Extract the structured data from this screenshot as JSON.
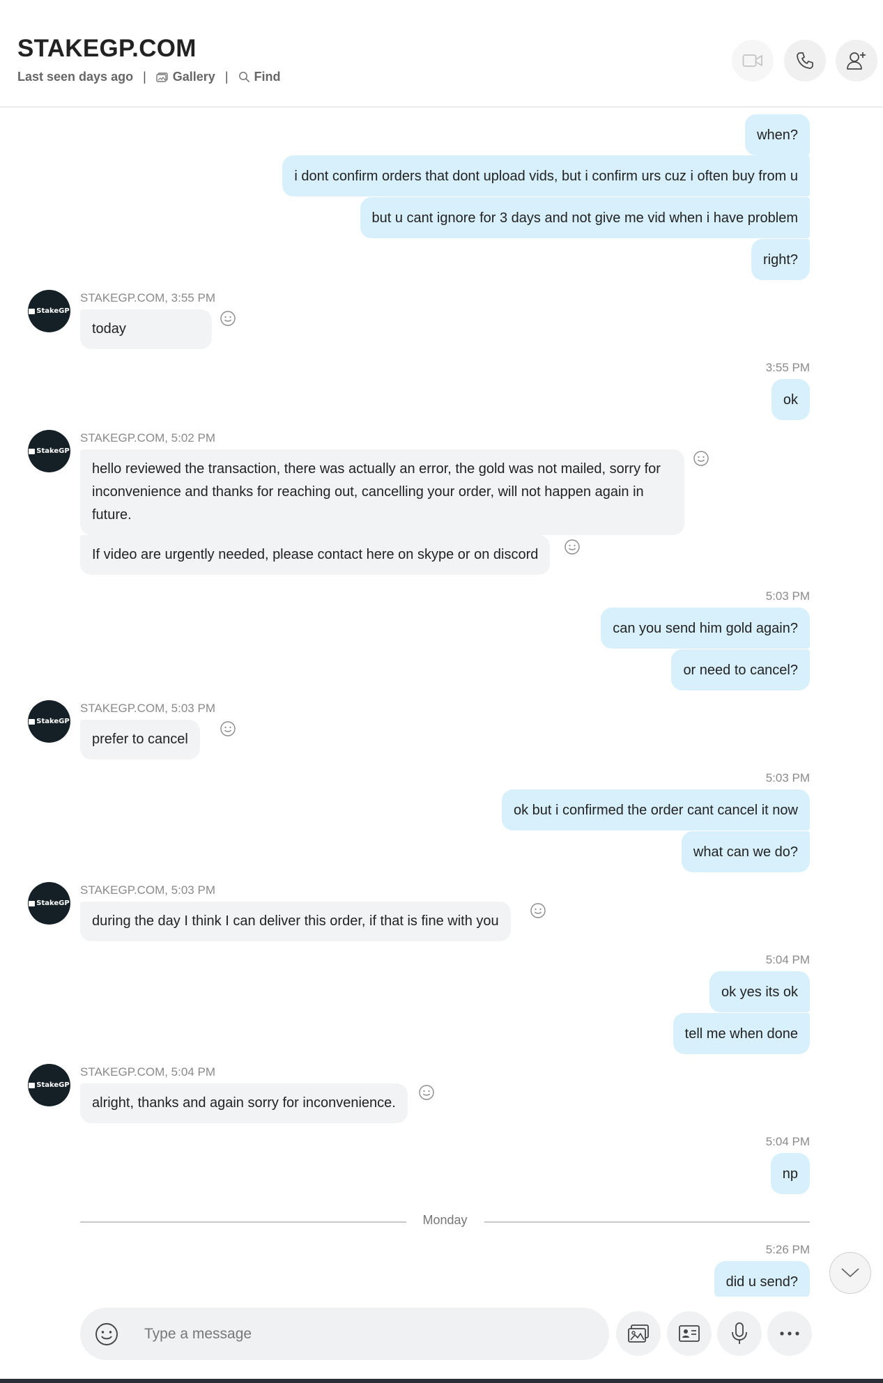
{
  "header": {
    "title": "STAKEGP.COM",
    "status": "Last seen days ago",
    "separator": "|",
    "gallery_label": "Gallery",
    "find_label": "Find",
    "buttons": [
      "video-call",
      "audio-call",
      "add-people"
    ]
  },
  "avatar_text": "StakeGP",
  "messages": {
    "out1": "when?",
    "out2": "i dont confirm orders that dont upload vids, but i confirm urs cuz i often buy from u",
    "out3": "but u cant ignore for 3 days and not give me vid when i have problem",
    "out4": "right?",
    "in1_sender": "STAKEGP.COM, 3:55 PM",
    "in1": "today",
    "out5_time": "3:55 PM",
    "out5": "ok",
    "in2_sender": "STAKEGP.COM, 5:02 PM",
    "in2": "hello reviewed the transaction, there was actually an error, the gold was not mailed, sorry for inconvenience and thanks for reaching out, cancelling your order, will not happen again in future.",
    "in3": "If video are urgently needed, please contact here on skype or on discord",
    "out6_time": "5:03 PM",
    "out6": "can you send him gold again?",
    "out7": "or need to cancel?",
    "in4_sender": "STAKEGP.COM, 5:03 PM",
    "in4": "prefer to cancel",
    "out8_time": "5:03 PM",
    "out8": "ok but i confirmed the order cant cancel it now",
    "out9": "what can we do?",
    "in5_sender": "STAKEGP.COM, 5:03 PM",
    "in5": "during the day I think I can deliver this order, if that is fine with you",
    "out10_time": "5:04 PM",
    "out10": "ok yes its ok",
    "out11": "tell me when done",
    "in6_sender": "STAKEGP.COM, 5:04 PM",
    "in6": "alright, thanks and again sorry for inconvenience.",
    "out12_time": "5:04 PM",
    "out12": "np",
    "divider": "Monday",
    "out13_time": "5:26 PM",
    "out13": "did u send?"
  },
  "composer": {
    "placeholder": "Type a message",
    "tools": [
      "gallery-icon",
      "contact-card-icon",
      "microphone-icon",
      "more-icon"
    ]
  },
  "colors": {
    "outgoing_bubble": "#d7f0fc",
    "incoming_bubble": "#f1f3f5",
    "avatar_bg": "#142026"
  }
}
